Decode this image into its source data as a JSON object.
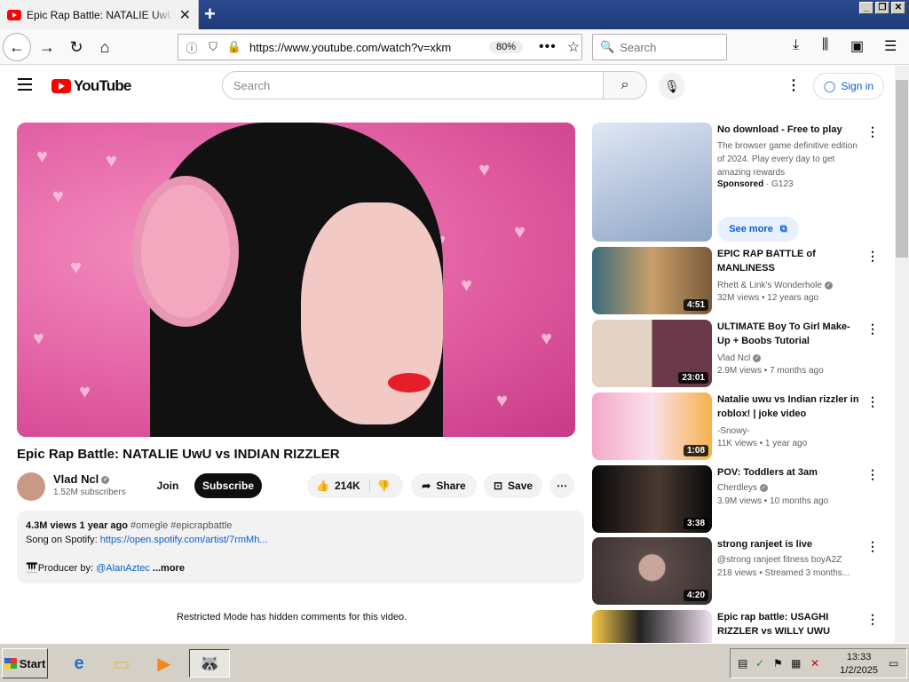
{
  "browser": {
    "tab_title": "Epic Rap Battle: NATALIE UwU vs INDIAN RIZZLER - YouTube",
    "url": "https://www.youtube.com/watch?v=xkm",
    "zoom": "80%",
    "search_placeholder": "Search",
    "window_buttons": [
      "_",
      "❐",
      "✕"
    ]
  },
  "header": {
    "logo_text": "YouTube",
    "search_placeholder": "Search",
    "signin_label": "Sign in"
  },
  "video": {
    "title": "Epic Rap Battle: NATALIE UwU vs INDIAN RIZZLER",
    "channel": "Vlad Ncl",
    "subscribers": "1.52M subscribers",
    "join_label": "Join",
    "subscribe_label": "Subscribe",
    "likes": "214K",
    "share_label": "Share",
    "save_label": "Save",
    "views": "4.3M views",
    "age": "1 year ago",
    "tags": "#omegle #epicrapbattle",
    "desc_line1_prefix": "Song on Spotify: ",
    "spotify_link": "https://open.spotify.com/artist/7rmMh...",
    "producer_prefix": "🎹Producer by: ",
    "producer_handle": "@AlanAztec",
    "more_label": "...more",
    "restricted_notice": "Restricted Mode has hidden comments for this video."
  },
  "sidebar": {
    "ad": {
      "title": "No download - Free to play",
      "desc": "The browser game definitive edition of 2024. Play every day to get amazing rewards",
      "sponsored": "Sponsored",
      "advertiser": " · G123",
      "see_more": "See more"
    },
    "items": [
      {
        "title": "EPIC RAP BATTLE of MANLINESS",
        "channel": "Rhett & Link's Wonderhole",
        "verified": true,
        "meta": "32M views • 12 years ago",
        "duration": "4:51"
      },
      {
        "title": "ULTIMATE Boy To Girl Make-Up + Boobs Tutorial",
        "channel": "Vlad Ncl",
        "verified": true,
        "meta": "2.9M views • 7 months ago",
        "duration": "23:01"
      },
      {
        "title": "Natalie uwu vs Indian rizzler in roblox! | joke video",
        "channel": "-Snowy-",
        "verified": false,
        "meta": "11K views • 1 year ago",
        "duration": "1:08"
      },
      {
        "title": "POV: Toddlers at 3am",
        "channel": "Cherdleys",
        "verified": true,
        "meta": "3.9M views • 10 months ago",
        "duration": "3:38"
      },
      {
        "title": "strong ranjeet is live",
        "channel": "@strong ranjeet fitness boyA2Z",
        "verified": false,
        "meta": "218 views • Streamed 3 months...",
        "duration": "4:20"
      },
      {
        "title": "Epic rap battle: USAGHI RIZZLER vs WILLY UWU",
        "channel": "",
        "verified": false,
        "meta": "",
        "duration": ""
      }
    ]
  },
  "taskbar": {
    "start_label": "Start",
    "time": "13:33",
    "date": "1/2/2025"
  }
}
